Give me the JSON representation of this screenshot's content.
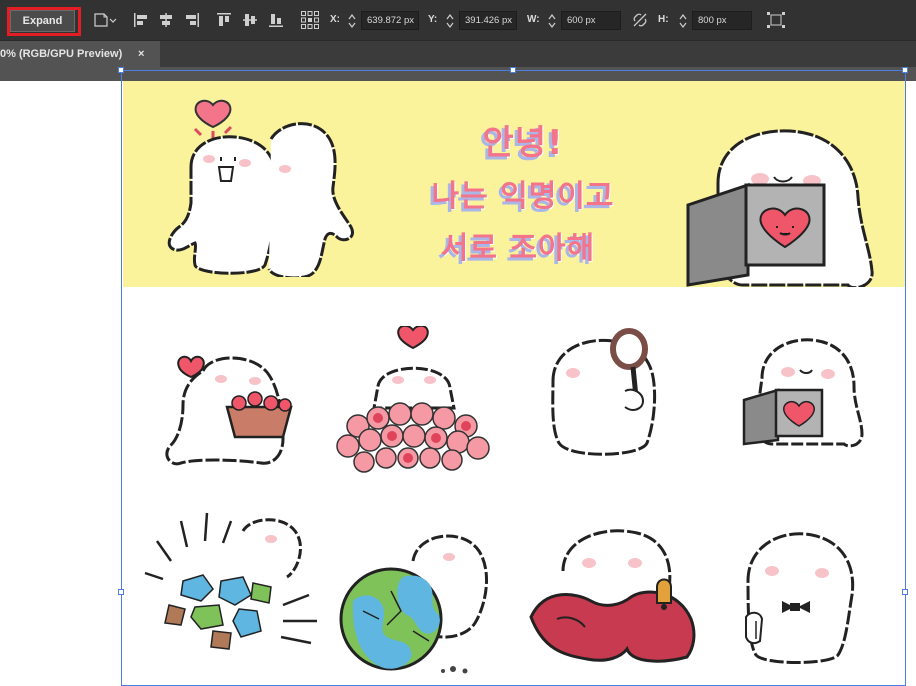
{
  "toolbar": {
    "expand_label": "Expand",
    "x_label": "X:",
    "x_value": "639.872 px",
    "y_label": "Y:",
    "y_value": "391.426 px",
    "w_label": "W:",
    "w_value": "600 px",
    "h_label": "H:",
    "h_value": "800 px",
    "accent": "#e21d23"
  },
  "tab": {
    "label": "0% (RGB/GPU Preview)",
    "close": "×"
  },
  "artwork": {
    "greeting_line1": "안녕!",
    "greeting_line2": "나는 익명이고",
    "greeting_line3": "서로 조아해",
    "banner_color": "#fbf39c",
    "text_color": "#f4748a",
    "shadow_color": "#aab6e8"
  }
}
